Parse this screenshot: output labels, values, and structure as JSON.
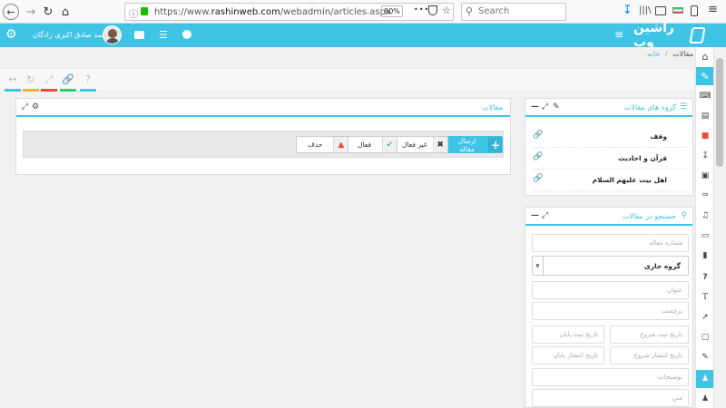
{
  "browser": {
    "url_prefix": "https://www.",
    "url_host": "rashinweb.com",
    "url_path": "/webadmin/articles.aspx",
    "zoom": "90%",
    "search_placeholder": "Search",
    "overflow": "•••"
  },
  "header": {
    "logo_text": "راشین وب",
    "user_name": "محمد صادق اکبری زادگان"
  },
  "breadcrumb": {
    "home": "خانه",
    "separator": "/",
    "current": "مقالات"
  },
  "toolstrip": {
    "colors": [
      "#3fc4e6",
      "#f2b134",
      "#e84c3d",
      "#2ecc71",
      "#3fc4e6"
    ]
  },
  "articles_panel": {
    "title": "مقالات",
    "buttons": {
      "send": "ارسال مقاله",
      "inactive": "غیر فعال",
      "active": "فعال",
      "delete": "حذف"
    }
  },
  "groups_panel": {
    "title": "گروه های مقالات",
    "items": [
      "وقف",
      "قرآن و احادیث",
      "اهل بیت علیهم السلام"
    ]
  },
  "search_panel": {
    "title": "جستجو در مقالات",
    "article_number_placeholder": "شماره مقاله",
    "group_select_value": "گروه جاری",
    "title_placeholder": "عنوان",
    "tag_placeholder": "برچسب",
    "reg_start_placeholder": "تاریخ ثبت شروع",
    "reg_end_placeholder": "تاریخ ثبت پایان",
    "pub_start_placeholder": "تاریخ انتشار شروع",
    "pub_end_placeholder": "تاریخ انتشار پایان",
    "desc_placeholder": "توضیحات",
    "text_placeholder": "متن"
  }
}
